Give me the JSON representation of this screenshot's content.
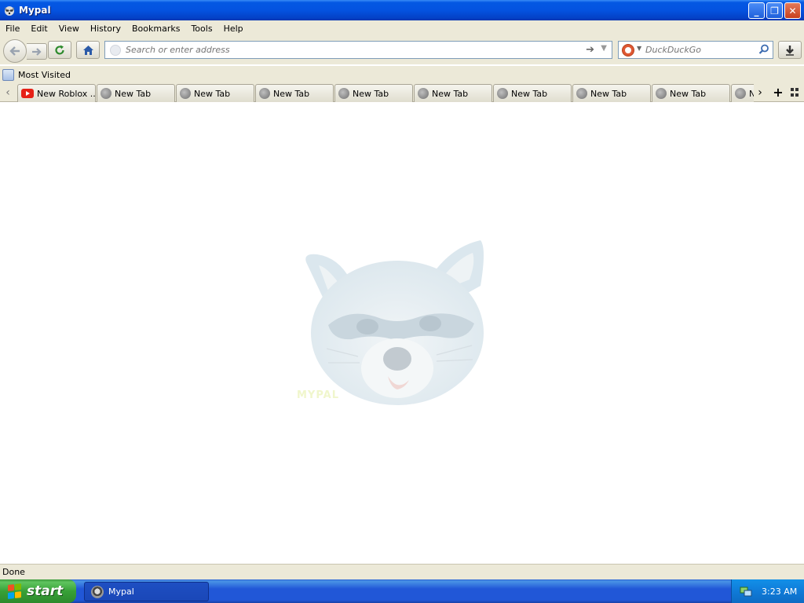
{
  "window": {
    "title": "Mypal",
    "buttons": {
      "minimize": "_",
      "restore": "❐",
      "close": "✕"
    }
  },
  "menu": [
    "File",
    "Edit",
    "View",
    "History",
    "Bookmarks",
    "Tools",
    "Help"
  ],
  "toolbar": {
    "url_placeholder": "Search or enter address",
    "search_placeholder": "DuckDuckGo",
    "search_engine": "DuckDuckGo"
  },
  "bookmarks": [
    {
      "label": "Most Visited",
      "icon": "bookmark-folder-icon"
    }
  ],
  "tabs": [
    {
      "label": "New Roblox ...",
      "icon": "youtube-icon"
    },
    {
      "label": "New Tab",
      "icon": "globe-icon"
    },
    {
      "label": "New Tab",
      "icon": "globe-icon"
    },
    {
      "label": "New Tab",
      "icon": "globe-icon"
    },
    {
      "label": "New Tab",
      "icon": "globe-icon"
    },
    {
      "label": "New Tab",
      "icon": "globe-icon"
    },
    {
      "label": "New Tab",
      "icon": "globe-icon"
    },
    {
      "label": "New Tab",
      "icon": "globe-icon"
    },
    {
      "label": "New Tab",
      "icon": "globe-icon"
    },
    {
      "label": "N",
      "icon": "globe-icon"
    }
  ],
  "content": {
    "logo_text": "MYPAL"
  },
  "status": {
    "text": "Done"
  },
  "taskbar": {
    "start_label": "start",
    "task_label": "Mypal",
    "clock": "3:23 AM"
  },
  "colors": {
    "titlebar": "#0453e0",
    "chrome": "#ece9d8",
    "taskbar": "#2157d7",
    "start": "#37a037",
    "tray": "#0f7bd8"
  }
}
